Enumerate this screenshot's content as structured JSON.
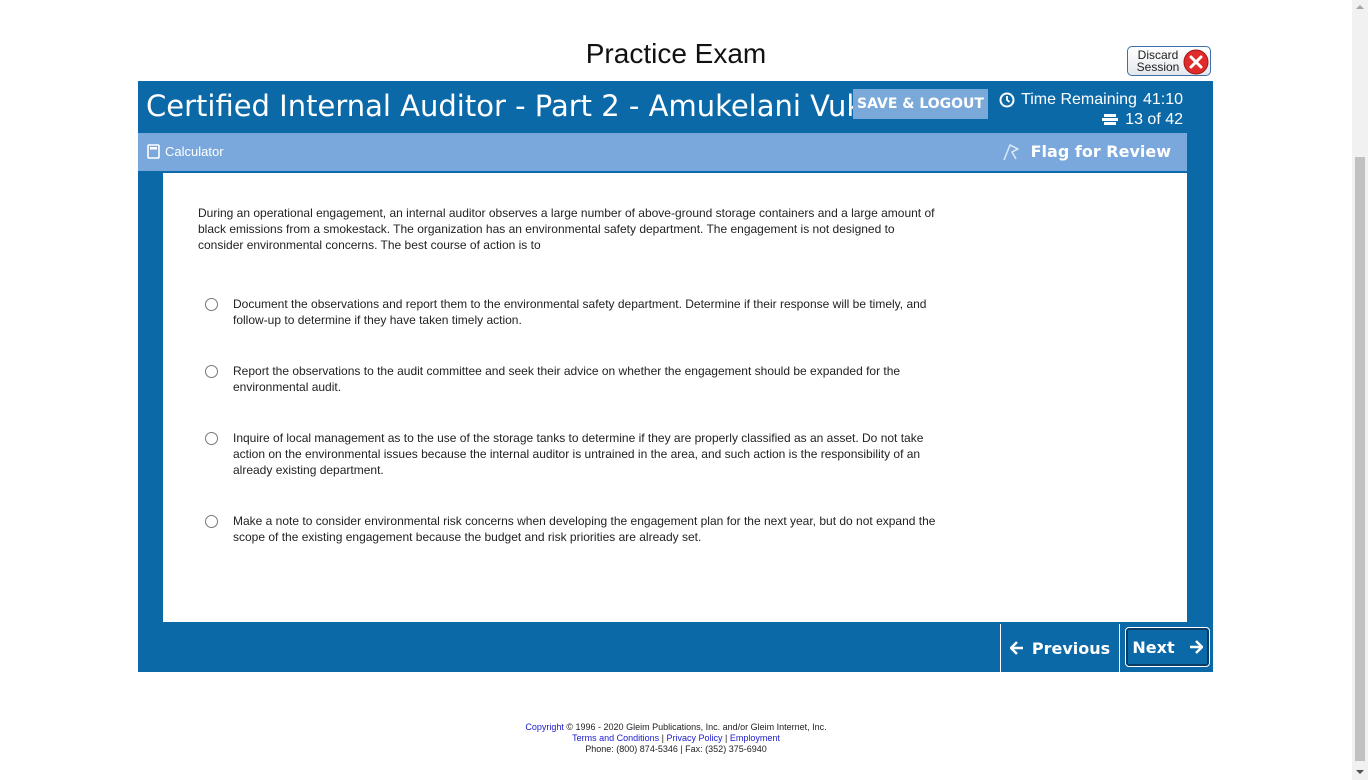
{
  "page": {
    "title": "Practice Exam"
  },
  "discard": {
    "label_line1": "Discard",
    "label_line2": "Session"
  },
  "header": {
    "title": "Certified Internal Auditor - Part 2 - Amukelani Vukela",
    "save_logout": "SAVE & LOGOUT",
    "time_remaining_label": "Time Remaining",
    "time_remaining": "41:10",
    "progress": "13 of 42"
  },
  "toolbar": {
    "calculator": "Calculator",
    "flag": "Flag for Review"
  },
  "question": {
    "stem": "During an operational engagement, an internal auditor observes a large number of above-ground storage containers and a large amount of black emissions from a smokestack. The organization has an environmental safety department. The engagement is not designed to consider environmental concerns. The best course of action is to",
    "choices": [
      {
        "text": "Document the observations and report them to the environmental safety department. Determine if their response will be timely, and follow-up to determine if they have taken timely action.",
        "selected": false
      },
      {
        "text": "Report the observations to the audit committee and seek their advice on whether the engagement should be expanded for the environmental audit.",
        "selected": false
      },
      {
        "text": "Inquire of local management as to the use of the storage tanks to determine if they are properly classified as an asset. Do not take action on the environmental issues because the internal auditor is untrained in the area, and such action is the responsibility of an already existing department.",
        "selected": false
      },
      {
        "text": "Make a note to consider environmental risk concerns when developing the engagement plan for the next year, but do not expand the scope of the existing engagement because the budget and risk priorities are already set.",
        "selected": false
      }
    ]
  },
  "nav": {
    "previous": "Previous",
    "next": "Next"
  },
  "footer": {
    "copyright_link": "Copyright",
    "copyright_text": "© 1996 - 2020 Gleim Publications, Inc. and/or Gleim Internet, Inc.",
    "terms": "Terms and Conditions",
    "privacy": "Privacy Policy",
    "employment": "Employment",
    "separator": "|",
    "phone": "Phone: (800) 874-5346 | Fax: (352) 375-6940"
  },
  "colors": {
    "frame": "#0b69a8",
    "toolbar": "#7aa8dd",
    "save_button": "#7aa8d9",
    "discard_icon": "#e02b2b"
  },
  "icons": {
    "discard": "close-circle-icon",
    "timer": "clock-icon",
    "progress": "stack-icon",
    "calculator": "calculator-icon",
    "flag": "flag-icon",
    "previous": "arrow-left-icon",
    "next": "arrow-right-icon"
  }
}
